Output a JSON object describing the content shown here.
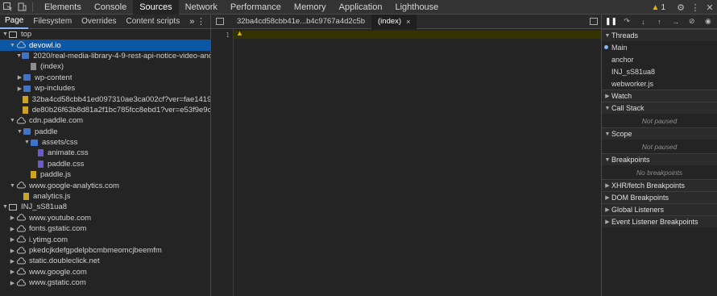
{
  "toolbar": {
    "tabs": [
      "Elements",
      "Console",
      "Sources",
      "Network",
      "Performance",
      "Memory",
      "Application",
      "Lighthouse"
    ],
    "active_tab": "Sources",
    "warning_count": "1"
  },
  "navigator": {
    "tabs": [
      "Page",
      "Filesystem",
      "Overrides",
      "Content scripts"
    ],
    "more": "»",
    "tree": [
      {
        "label": "top",
        "depth": 0,
        "icon": "frame",
        "arrow": "down",
        "selected": false
      },
      {
        "label": "devowl.io",
        "depth": 1,
        "icon": "cloud",
        "arrow": "down",
        "selected": true
      },
      {
        "label": "2020/real-media-library-4-9-rest-api-notice-video-and-translation/",
        "depth": 2,
        "icon": "folder",
        "arrow": "down",
        "selected": false
      },
      {
        "label": "(index)",
        "depth": 3,
        "icon": "file-gray",
        "arrow": "",
        "selected": false
      },
      {
        "label": "wp-content",
        "depth": 2,
        "icon": "folder",
        "arrow": "right",
        "selected": false
      },
      {
        "label": "wp-includes",
        "depth": 2,
        "icon": "folder",
        "arrow": "right",
        "selected": false
      },
      {
        "label": "32ba4cd58cbb41ed097310ae3ca002cf?ver=fae14194c266c6",
        "depth": 2,
        "icon": "file-yellow",
        "arrow": "",
        "selected": false
      },
      {
        "label": "de80b26f63b8d81a2f1bc785fcc8ebd1?ver=e53f9e9cec5251a",
        "depth": 2,
        "icon": "file-yellow",
        "arrow": "",
        "selected": false
      },
      {
        "label": "cdn.paddle.com",
        "depth": 1,
        "icon": "cloud",
        "arrow": "down",
        "selected": false
      },
      {
        "label": "paddle",
        "depth": 2,
        "icon": "folder",
        "arrow": "down",
        "selected": false
      },
      {
        "label": "assets/css",
        "depth": 3,
        "icon": "folder",
        "arrow": "down",
        "selected": false
      },
      {
        "label": "animate.css",
        "depth": 4,
        "icon": "file-purple",
        "arrow": "",
        "selected": false
      },
      {
        "label": "paddle.css",
        "depth": 4,
        "icon": "file-purple",
        "arrow": "",
        "selected": false
      },
      {
        "label": "paddle.js",
        "depth": 3,
        "icon": "file-yellow",
        "arrow": "",
        "selected": false
      },
      {
        "label": "www.google-analytics.com",
        "depth": 1,
        "icon": "cloud",
        "arrow": "down",
        "selected": false
      },
      {
        "label": "analytics.js",
        "depth": 2,
        "icon": "file-yellow",
        "arrow": "",
        "selected": false
      },
      {
        "label": "INJ_sS81ua8",
        "depth": 0,
        "icon": "frame",
        "arrow": "down",
        "selected": false
      },
      {
        "label": "www.youtube.com",
        "depth": 1,
        "icon": "cloud",
        "arrow": "right",
        "selected": false
      },
      {
        "label": "fonts.gstatic.com",
        "depth": 1,
        "icon": "cloud",
        "arrow": "right",
        "selected": false
      },
      {
        "label": "i.ytimg.com",
        "depth": 1,
        "icon": "cloud",
        "arrow": "right",
        "selected": false
      },
      {
        "label": "pkedcjkdefgpdelpbcmbmeomcjbeemfm",
        "depth": 1,
        "icon": "cloud",
        "arrow": "right",
        "selected": false
      },
      {
        "label": "static.doubleclick.net",
        "depth": 1,
        "icon": "cloud",
        "arrow": "right",
        "selected": false
      },
      {
        "label": "www.google.com",
        "depth": 1,
        "icon": "cloud",
        "arrow": "right",
        "selected": false
      },
      {
        "label": "www.gstatic.com",
        "depth": 1,
        "icon": "cloud",
        "arrow": "right",
        "selected": false
      }
    ]
  },
  "editor": {
    "tabs": [
      {
        "label": "32ba4cd58cbb41e...b4c9767a4d2c5b",
        "active": false
      },
      {
        "label": "(index)",
        "active": true,
        "close": "×"
      }
    ],
    "line_number": "1"
  },
  "debugger": {
    "sections": {
      "threads": "Threads",
      "watch": "Watch",
      "call_stack": "Call Stack",
      "scope": "Scope",
      "breakpoints": "Breakpoints",
      "xhr": "XHR/fetch Breakpoints",
      "dom": "DOM Breakpoints",
      "global": "Global Listeners",
      "event": "Event Listener Breakpoints"
    },
    "threads": [
      "Main",
      "anchor",
      "INJ_sS81ua8",
      "webworker.js"
    ],
    "not_paused": "Not paused",
    "no_breakpoints": "No breakpoints"
  }
}
